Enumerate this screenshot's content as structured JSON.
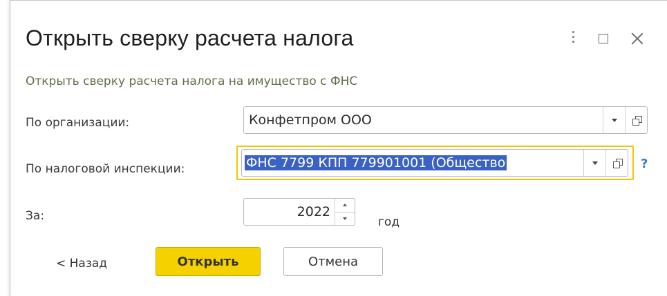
{
  "dialog": {
    "title": "Открыть сверку расчета налога",
    "subtitle": "Открыть сверку расчета налога на имущество с ФНС"
  },
  "fields": {
    "organization": {
      "label": "По организации:",
      "value": "Конфетпром ООО"
    },
    "tax_inspection": {
      "label": "По налоговой инспекции:",
      "value": "ФНС 7799 КПП 779901001 (Общество"
    },
    "period": {
      "label": "За:",
      "value": "2022",
      "unit": "год"
    }
  },
  "buttons": {
    "back": "< Назад",
    "open": "Открыть",
    "cancel": "Отмена"
  },
  "help": "?",
  "colors": {
    "accent_yellow": "#f6d100",
    "focus_border": "#f2c500",
    "selection_blue": "#3a61c4",
    "help_blue": "#3d79c9",
    "subtitle_green": "#5f6e48"
  },
  "icons": [
    "more-icon",
    "maximize-icon",
    "close-icon",
    "dropdown-icon",
    "open-in-window-icon",
    "help-icon",
    "spin-up-icon",
    "spin-down-icon"
  ]
}
